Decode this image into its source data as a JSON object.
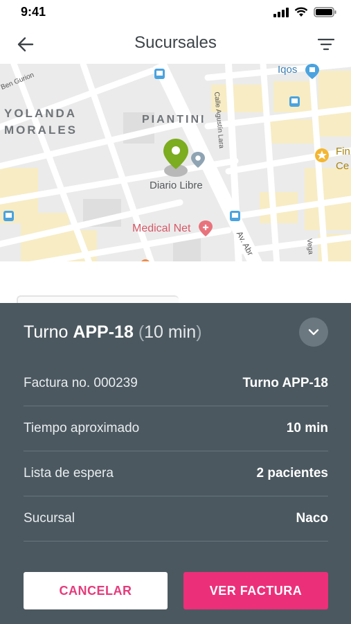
{
  "status_bar": {
    "time": "9:41"
  },
  "header": {
    "title": "Sucursales"
  },
  "map": {
    "areas": [
      "YOLANDA",
      "MORALES",
      "PIANTINI"
    ],
    "streets": [
      "Ben Gurion",
      "Calle Agustín Lara",
      "Av. Abr",
      "Vega"
    ],
    "pois": {
      "diario": "Diario Libre",
      "medical": "Medical Net",
      "iqos": "Iqos",
      "fin": "Fin",
      "ce": "Ce"
    }
  },
  "sheet": {
    "title_prefix": "Turno ",
    "title_code": "APP-18",
    "title_open": " (",
    "title_duration": "10 min",
    "title_close": ")",
    "rows": [
      {
        "label": "Factura no. 000239",
        "value": "Turno APP-18"
      },
      {
        "label": "Tiempo aproximado",
        "value": "10 min"
      },
      {
        "label": "Lista de espera",
        "value": "2 pacientes"
      },
      {
        "label": "Sucursal",
        "value": "Naco"
      }
    ],
    "cancel_label": "CANCELAR",
    "invoice_label": "VER FACTURA"
  },
  "colors": {
    "accent": "#ec2f79",
    "sheet_bg": "#4b5860",
    "pin": "#7cac1f"
  }
}
